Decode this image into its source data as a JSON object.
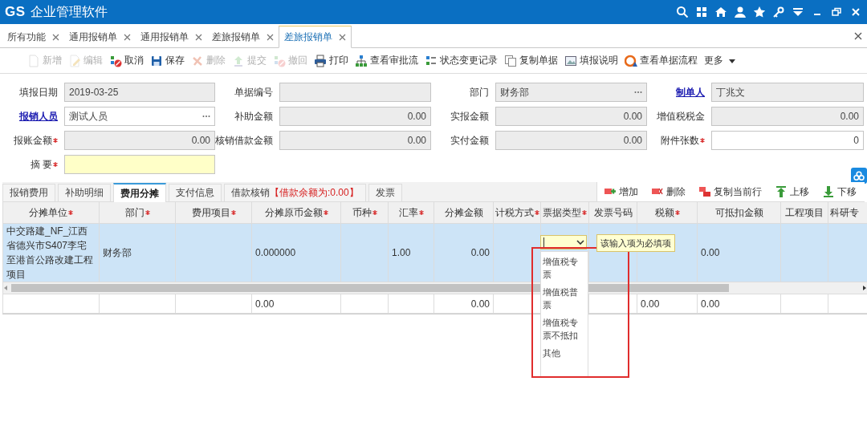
{
  "app": {
    "logo": "GS",
    "title": "企业管理软件"
  },
  "doc_tabs": [
    {
      "label": "所有功能",
      "selected": false
    },
    {
      "label": "通用报销单",
      "selected": false
    },
    {
      "label": "通用报销单",
      "selected": false
    },
    {
      "label": "差旅报销单",
      "selected": false
    },
    {
      "label": "差旅报销单",
      "selected": true
    }
  ],
  "toolbar": [
    {
      "label": "新增",
      "kind": "new",
      "disabled": true
    },
    {
      "label": "编辑",
      "kind": "edit",
      "disabled": true
    },
    {
      "label": "取消",
      "kind": "cancel",
      "disabled": false
    },
    {
      "label": "保存",
      "kind": "save",
      "disabled": false
    },
    {
      "label": "删除",
      "kind": "delete",
      "disabled": true
    },
    {
      "label": "提交",
      "kind": "submit",
      "disabled": true
    },
    {
      "label": "撤回",
      "kind": "revoke",
      "disabled": true
    },
    {
      "label": "打印",
      "kind": "print",
      "disabled": false
    },
    {
      "label": "查看审批流",
      "kind": "approval",
      "disabled": false
    },
    {
      "label": "状态变更记录",
      "kind": "log",
      "disabled": false
    },
    {
      "label": "复制单据",
      "kind": "copy",
      "disabled": false
    },
    {
      "label": "填报说明",
      "kind": "help",
      "disabled": false
    },
    {
      "label": "查看单据流程",
      "kind": "flow",
      "disabled": false
    },
    {
      "label": "更多",
      "kind": "more",
      "disabled": false
    }
  ],
  "form": {
    "fields": [
      {
        "label": "填报日期",
        "value": "2019-03-25",
        "kind": "text",
        "readonly": true,
        "highlighted": false,
        "picker": false,
        "link": false,
        "required": false
      },
      {
        "label": "单据编号",
        "kind": "text",
        "readonly": true,
        "highlighted": false,
        "picker": false,
        "link": false,
        "required": false
      },
      {
        "label": "部门",
        "value": "财务部",
        "kind": "text",
        "readonly": true,
        "highlighted": false,
        "picker": true,
        "link": false,
        "required": false
      },
      {
        "label": "制单人",
        "value": "丁兆文",
        "kind": "text",
        "readonly": true,
        "highlighted": false,
        "picker": false,
        "link": true,
        "required": false
      },
      {
        "label": "报销人员",
        "value": "测试人员",
        "kind": "text",
        "readonly": false,
        "highlighted": false,
        "picker": true,
        "link": true,
        "required": false
      },
      {
        "label": "补助金额",
        "value": "0.00",
        "kind": "number",
        "readonly": true,
        "highlighted": false,
        "picker": false,
        "link": false,
        "required": false
      },
      {
        "label": "实报金额",
        "value": "0.00",
        "kind": "number",
        "readonly": true,
        "highlighted": false,
        "picker": false,
        "link": false,
        "required": false
      },
      {
        "label": "增值税税金",
        "value": "0.00",
        "kind": "number",
        "readonly": true,
        "highlighted": false,
        "picker": false,
        "link": false,
        "required": false
      },
      {
        "label": "报账金额",
        "value": "0.00",
        "kind": "number",
        "readonly": true,
        "highlighted": false,
        "picker": false,
        "link": false,
        "required": true
      },
      {
        "label": "核销借款金额",
        "value": "0.00",
        "kind": "number",
        "readonly": true,
        "highlighted": false,
        "picker": false,
        "link": false,
        "required": false
      },
      {
        "label": "实付金额",
        "value": "0.00",
        "kind": "number",
        "readonly": true,
        "highlighted": false,
        "picker": false,
        "link": false,
        "required": false
      },
      {
        "label": "附件张数",
        "value": "0",
        "kind": "number",
        "readonly": false,
        "highlighted": false,
        "picker": false,
        "link": false,
        "required": true
      },
      {
        "label": "摘 要",
        "kind": "text",
        "readonly": false,
        "highlighted": true,
        "picker": false,
        "link": false,
        "required": true
      }
    ]
  },
  "detail_tabs": [
    {
      "label": "报销费用",
      "selected": false
    },
    {
      "label": "补助明细",
      "selected": false
    },
    {
      "label": "费用分摊",
      "selected": true
    },
    {
      "label": "支付信息",
      "selected": false
    },
    {
      "label": "借款核销",
      "note": "【借款余额为:0.00】",
      "selected": false
    },
    {
      "label": "发票",
      "selected": false
    }
  ],
  "grid_actions": [
    {
      "label": "增加",
      "kind": "add"
    },
    {
      "label": "删除",
      "kind": "delete"
    },
    {
      "label": "复制当前行",
      "kind": "copy"
    },
    {
      "label": "上移",
      "kind": "up"
    },
    {
      "label": "下移",
      "kind": "down"
    }
  ],
  "grid": {
    "columns": [
      {
        "label": "分摊单位",
        "required": true
      },
      {
        "label": "部门",
        "required": true
      },
      {
        "label": "费用项目",
        "required": true
      },
      {
        "label": "分摊原币金额",
        "required": true,
        "total": "0.00"
      },
      {
        "label": "币种",
        "required": true
      },
      {
        "label": "汇率",
        "required": true
      },
      {
        "label": "分摊金额",
        "required": false,
        "total": "0.00"
      },
      {
        "label": "计税方式",
        "required": true
      },
      {
        "label": "票据类型",
        "required": true
      },
      {
        "label": "发票号码",
        "required": false
      },
      {
        "label": "税额",
        "required": true,
        "total": "0.00"
      },
      {
        "label": "可抵扣金额",
        "required": false,
        "total": "0.00"
      },
      {
        "label": "工程项目",
        "required": false
      },
      {
        "label": "科研专",
        "required": false
      }
    ],
    "rows": [
      {
        "selected": true,
        "cells": [
          {
            "text": "中交路建_NF_江西省德兴市S407李宅至港首公路改建工程项目"
          },
          {
            "text": "财务部"
          },
          {},
          {
            "text": "0.000000"
          },
          {},
          {
            "text": "1.00"
          },
          {
            "text": "0.00"
          },
          {},
          {},
          {},
          {},
          {
            "text": "0.00"
          },
          {},
          {}
        ]
      }
    ],
    "dropdown": {
      "open": true,
      "highlighted": true,
      "options": [
        "增值税专票",
        "增值税普票",
        "增值税专票不抵扣",
        "其他"
      ],
      "tooltip": "该输入项为必填项"
    }
  }
}
